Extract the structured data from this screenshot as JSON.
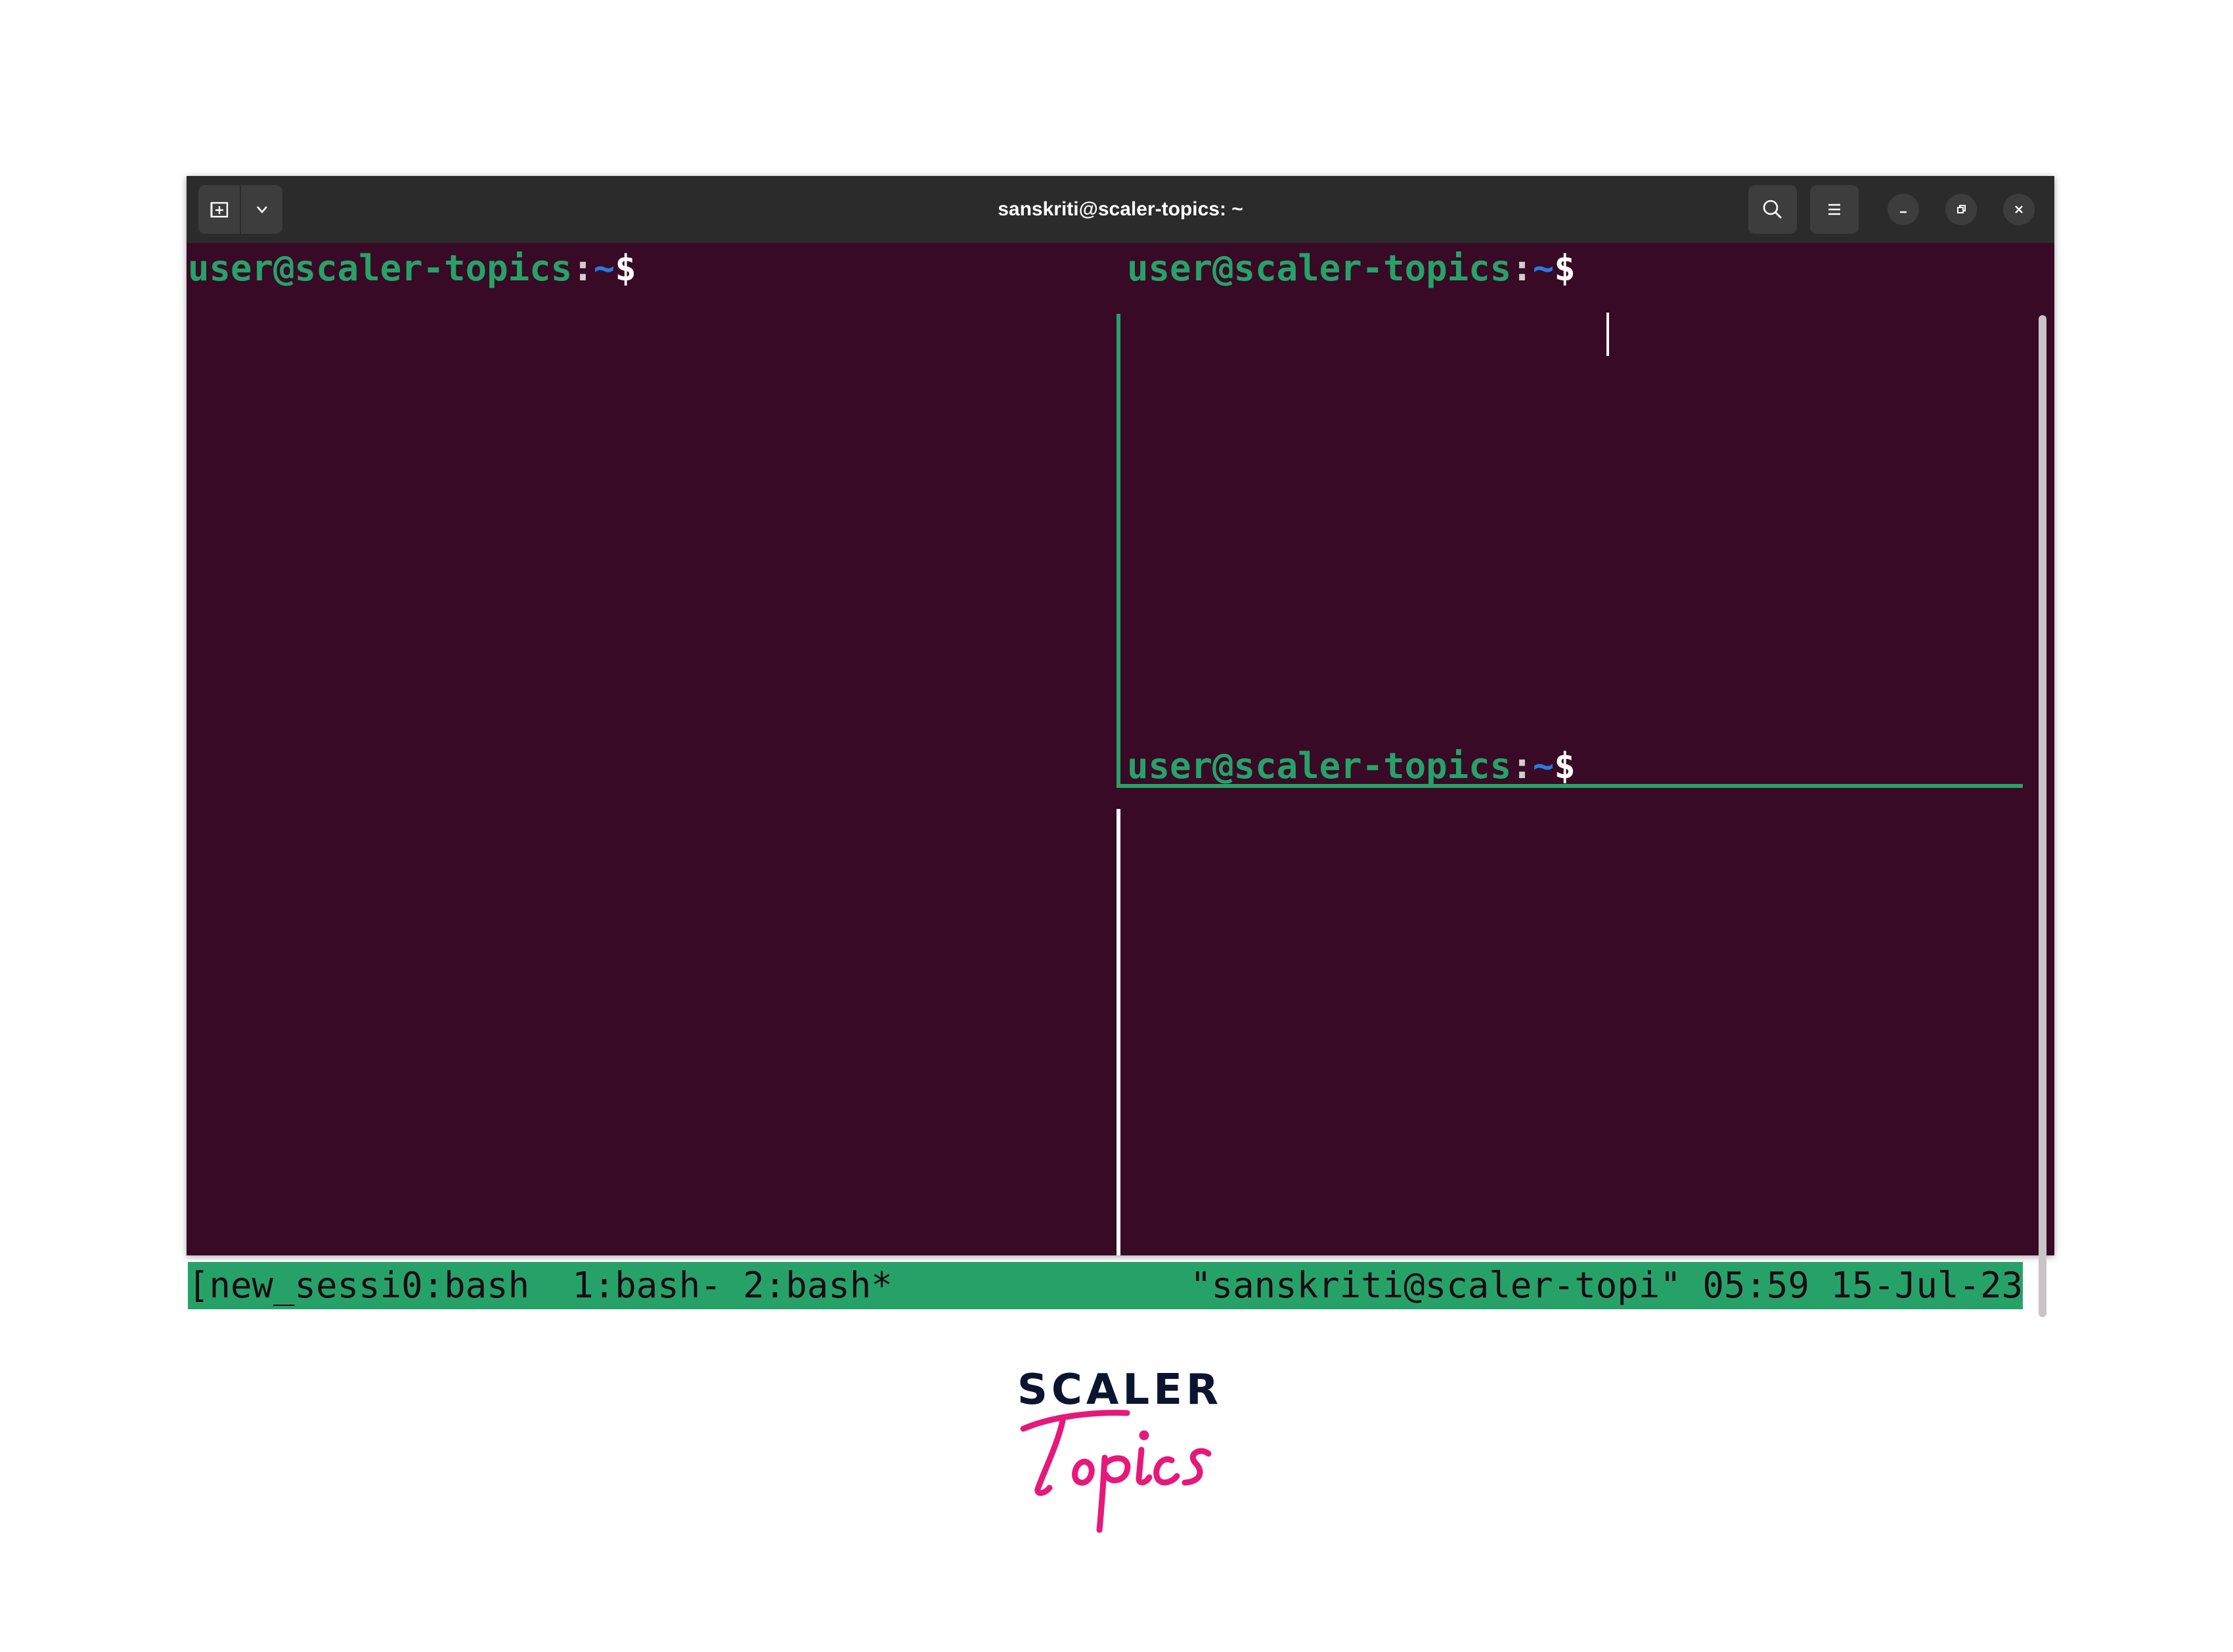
{
  "window": {
    "title": "sanskriti@scaler-topics: ~",
    "icons": {
      "new_tab": "new-tab-icon",
      "dropdown": "chevron-down-icon",
      "search": "search-icon",
      "menu": "hamburger-menu-icon",
      "minimize": "minimize-icon",
      "restore": "restore-icon",
      "close": "close-icon"
    }
  },
  "panes": [
    {
      "user": "user@scaler-topics",
      "colon": ":",
      "path": "~",
      "symbol": "$"
    },
    {
      "user": "user@scaler-topics",
      "colon": ":",
      "path": "~",
      "symbol": "$"
    },
    {
      "user": "user@scaler-topics",
      "colon": ":",
      "path": "~",
      "symbol": "$"
    }
  ],
  "statusbar": {
    "left": "[new_sessi0:bash  1:bash- 2:bash*",
    "right": "\"sanskriti@scaler-topi\" 05:59 15-Jul-23"
  },
  "colors": {
    "terminal_bg": "#380a26",
    "prompt_green": "#26a269",
    "path_blue": "#2a7bde",
    "titlebar": "#2b2b2b",
    "logo_navy": "#0b1530",
    "logo_pink": "#e5197a"
  },
  "logo": {
    "top_word": "SCALER",
    "script_word": "Topics"
  }
}
